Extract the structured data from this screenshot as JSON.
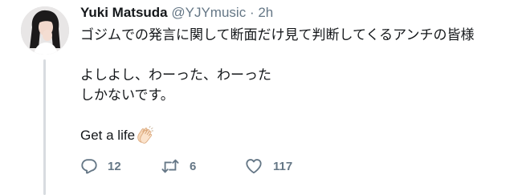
{
  "tweet": {
    "display_name": "Yuki Matsuda",
    "handle": "@YJYmusic",
    "separator": "·",
    "time": "2h",
    "lines": [
      "ゴジムでの発言に関して断面だけ見て判断してくるアンチの皆様",
      "よしよし、わーった、わーった",
      "しかないです。",
      "Get a life"
    ],
    "emoji": "clapping-hands"
  },
  "actions": {
    "reply_count": "12",
    "retweet_count": "6",
    "like_count": "117"
  },
  "colors": {
    "text": "#14171a",
    "muted": "#657786",
    "thread_line": "#d8dce0"
  },
  "icons": [
    "reply-icon",
    "retweet-icon",
    "like-icon",
    "clap-emoji"
  ]
}
